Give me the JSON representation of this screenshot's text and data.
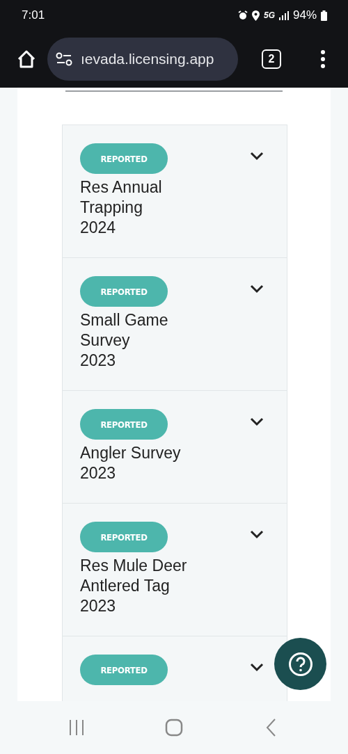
{
  "status_bar": {
    "time": "7:01",
    "network": "5G",
    "battery": "94%"
  },
  "browser": {
    "url": "ıevada.licensing.app",
    "tab_count": "2"
  },
  "cards": [
    {
      "status": "REPORTED",
      "title": "Res Annual Trapping",
      "year": "2024",
      "expanded": false
    },
    {
      "status": "REPORTED",
      "title": "Small Game Survey",
      "year": "2023",
      "expanded": false
    },
    {
      "status": "REPORTED",
      "title": "Angler Survey",
      "year": "2023",
      "expanded": false
    },
    {
      "status": "REPORTED",
      "title": "Res Mule Deer Antlered Tag",
      "year": "2023",
      "expanded": false
    },
    {
      "status": "REPORTED",
      "expanded": false
    }
  ]
}
